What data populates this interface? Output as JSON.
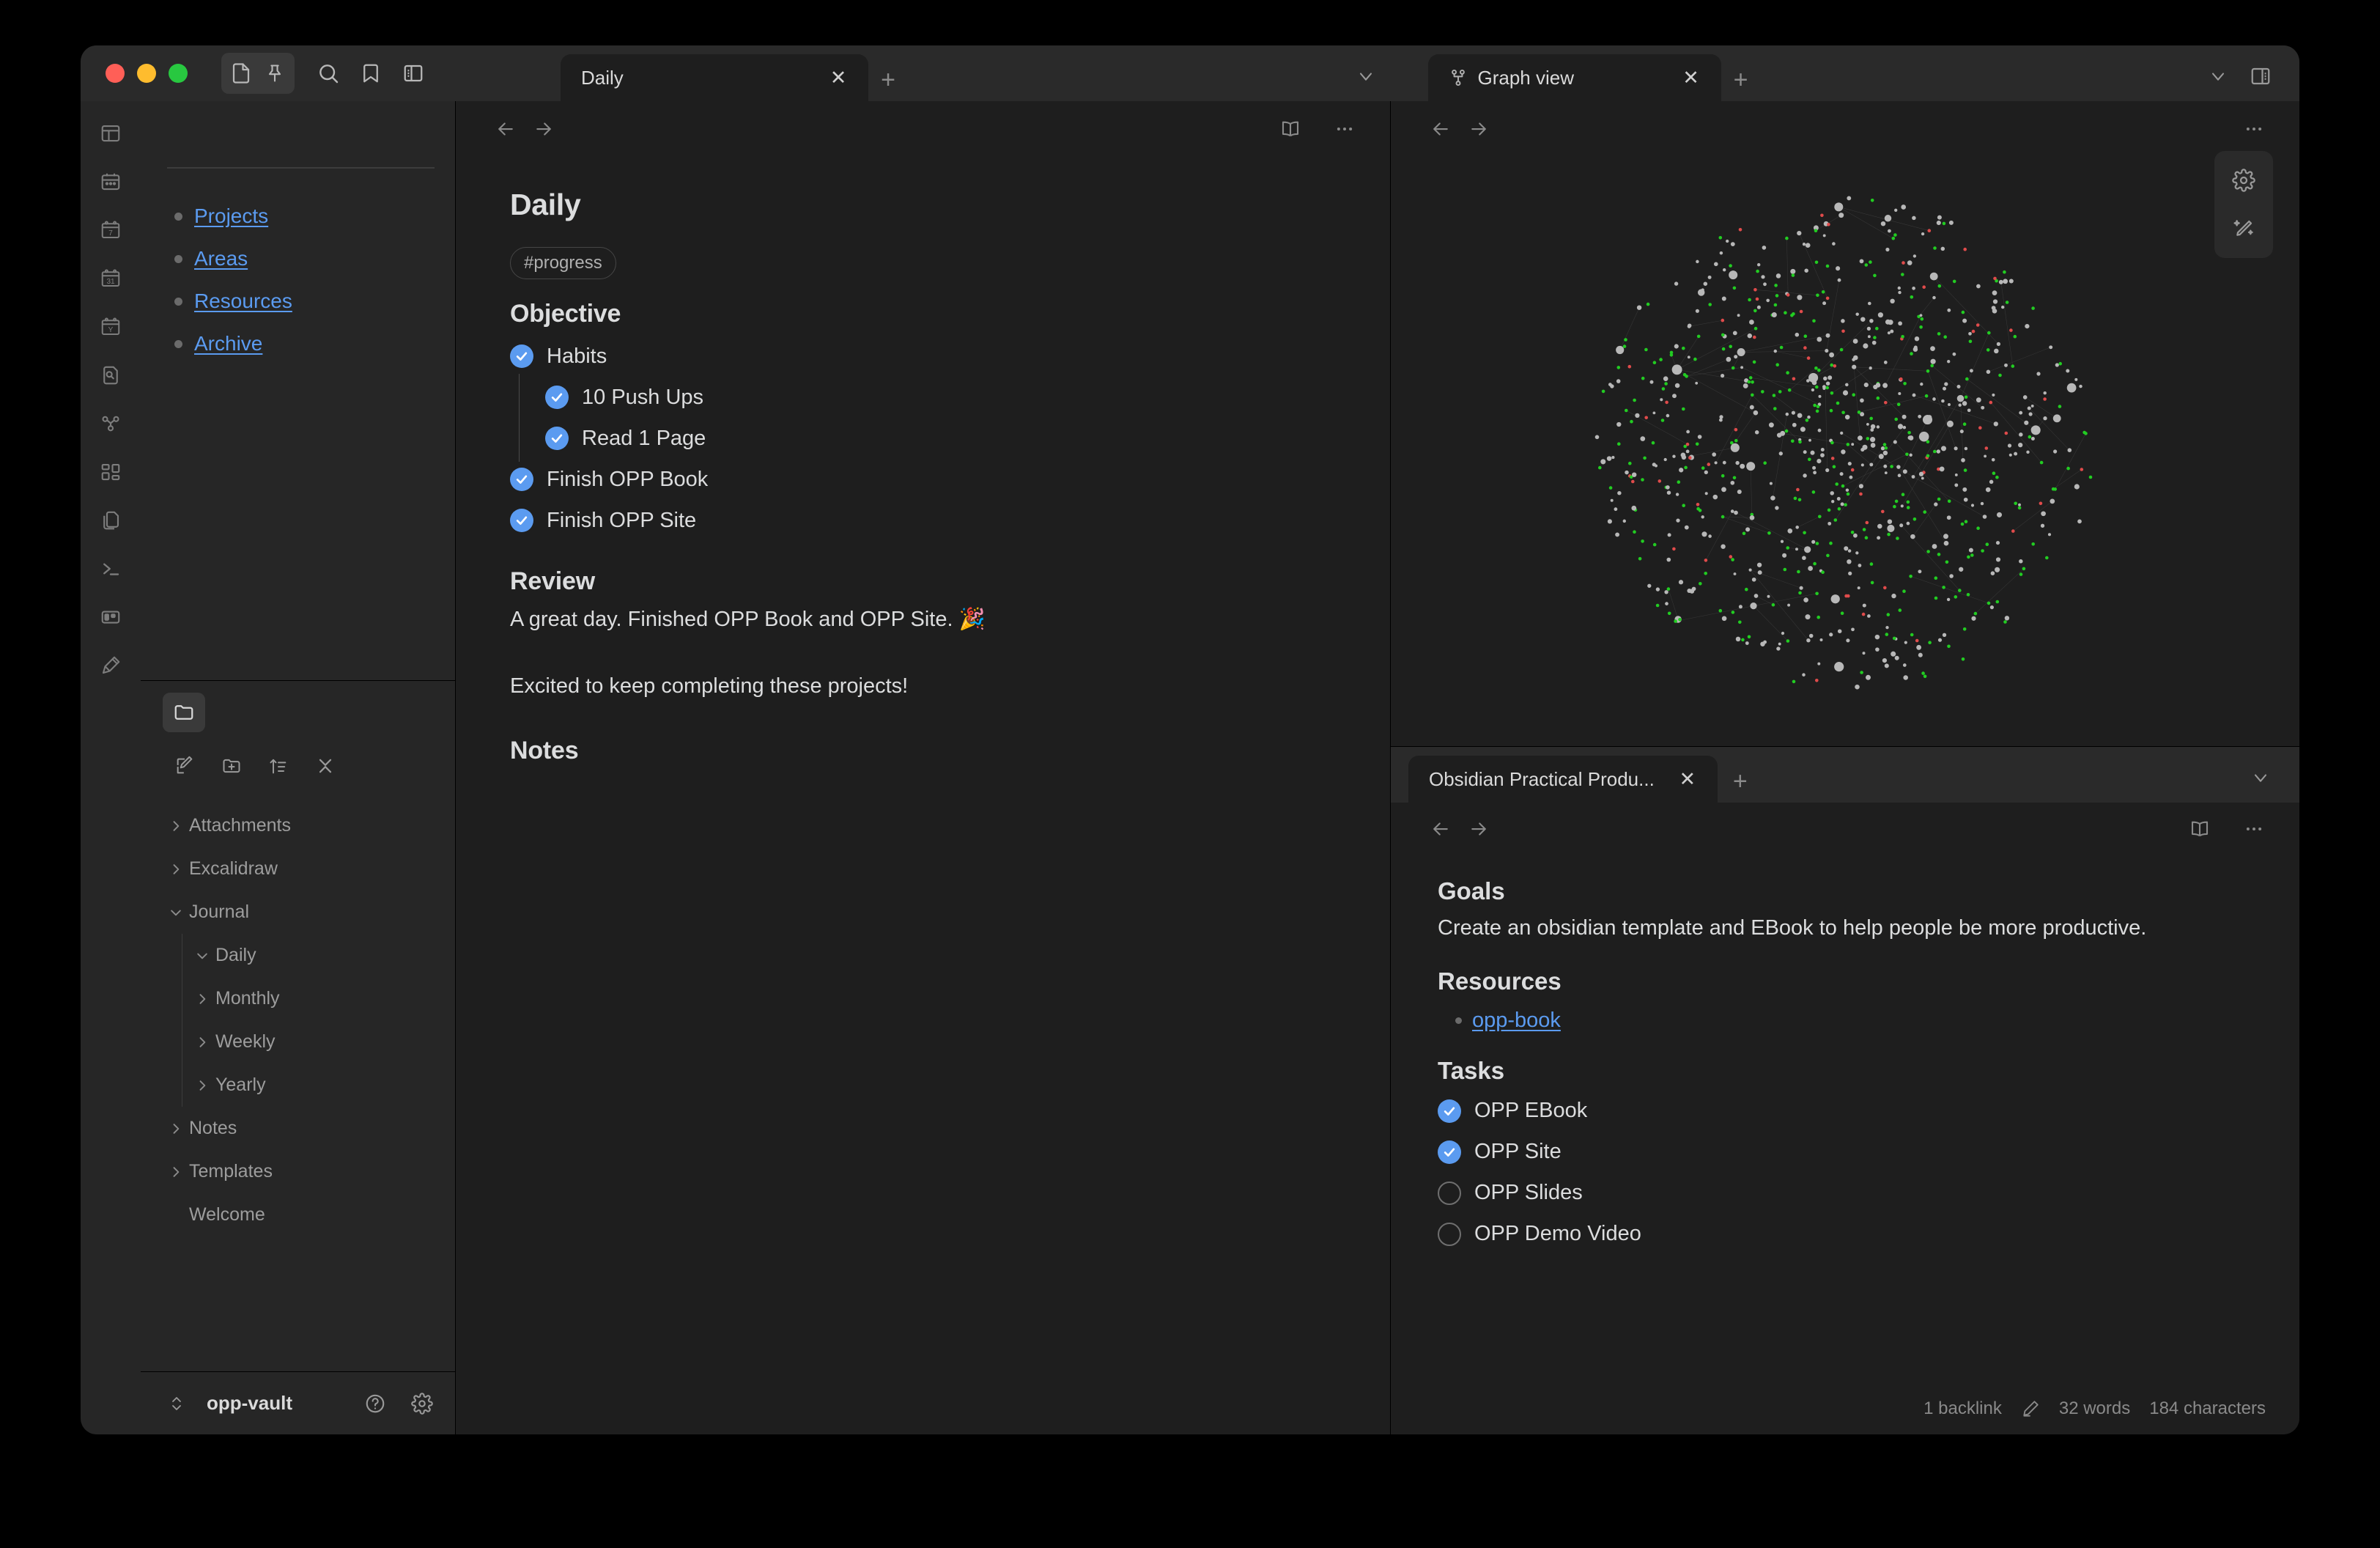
{
  "window": {
    "traffic_lights": [
      "close",
      "minimize",
      "maximize"
    ],
    "toolbar_icons": [
      "file-icon",
      "pin-icon",
      "search-icon",
      "bookmark-icon",
      "toggle-right-sidebar-icon"
    ]
  },
  "rail": {
    "items": [
      {
        "name": "layout-icon",
        "label": "Layout"
      },
      {
        "name": "calendar-icon",
        "label": "Calendar"
      },
      {
        "name": "calendar-weekly-icon",
        "label": "7"
      },
      {
        "name": "calendar-monthly-icon",
        "label": "31"
      },
      {
        "name": "calendar-yearly-icon",
        "label": "Y"
      },
      {
        "name": "file-search-icon",
        "label": "Search in file"
      },
      {
        "name": "graph-icon",
        "label": "Graph view"
      },
      {
        "name": "grid-icon",
        "label": "Dashboard"
      },
      {
        "name": "files-icon",
        "label": "Files"
      },
      {
        "name": "terminal-icon",
        "label": "Terminal"
      },
      {
        "name": "kanban-icon",
        "label": "Kanban"
      },
      {
        "name": "excalidraw-icon",
        "label": "Excalidraw"
      }
    ]
  },
  "sidebar": {
    "para_links": [
      "Projects",
      "Areas",
      "Resources",
      "Archive"
    ],
    "explorer_actions": [
      "new-note-icon",
      "new-folder-icon",
      "sort-icon",
      "collapse-all-icon"
    ],
    "tree": [
      {
        "label": "Attachments",
        "level": 1,
        "state": "collapsed"
      },
      {
        "label": "Excalidraw",
        "level": 1,
        "state": "collapsed"
      },
      {
        "label": "Journal",
        "level": 1,
        "state": "expanded"
      },
      {
        "label": "Daily",
        "level": 2,
        "state": "expanded"
      },
      {
        "label": "Monthly",
        "level": 2,
        "state": "collapsed"
      },
      {
        "label": "Weekly",
        "level": 2,
        "state": "collapsed"
      },
      {
        "label": "Yearly",
        "level": 2,
        "state": "collapsed"
      },
      {
        "label": "Notes",
        "level": 1,
        "state": "collapsed"
      },
      {
        "label": "Templates",
        "level": 1,
        "state": "collapsed"
      },
      {
        "label": "Welcome",
        "level": 1,
        "state": "file"
      }
    ],
    "vault_name": "opp-vault",
    "footer_icons": [
      "vault-switcher-icon",
      "help-icon",
      "settings-icon"
    ]
  },
  "center_pane": {
    "tab": {
      "label": "Daily",
      "close": "✕"
    },
    "new_tab": "+",
    "chevron": "⌄",
    "header_icons": [
      "back-icon",
      "forward-icon",
      "reading-mode-icon",
      "more-options-icon"
    ],
    "note": {
      "title": "Daily",
      "tag": "#progress",
      "objective_heading": "Objective",
      "tasks": [
        {
          "label": "Habits",
          "checked": true,
          "indent": 0
        },
        {
          "label": "10 Push Ups",
          "checked": true,
          "indent": 1
        },
        {
          "label": "Read 1 Page",
          "checked": true,
          "indent": 1
        },
        {
          "label": "Finish OPP Book",
          "checked": true,
          "indent": 0
        },
        {
          "label": "Finish OPP Site",
          "checked": true,
          "indent": 0
        }
      ],
      "review_heading": "Review",
      "review_line1": "A great day. Finished OPP Book and OPP Site. 🎉",
      "review_line2": "Excited to keep completing these projects!",
      "notes_heading": "Notes"
    }
  },
  "graph_pane": {
    "tab": {
      "label": "Graph view",
      "close": "✕",
      "icon": "graph-icon"
    },
    "new_tab": "+",
    "chevron": "⌄",
    "sidebar_toggle_icon": "toggle-right-sidebar-icon",
    "header_icons": [
      "back-icon",
      "forward-icon",
      "more-options-icon"
    ],
    "controls": [
      "graph-settings-icon",
      "graph-forces-icon"
    ],
    "node_colors": {
      "default": "#b8b8b8",
      "tag": "#22cc22",
      "unresolved": "#e04b4b",
      "edge": "#4a4a4a"
    }
  },
  "bottom_pane": {
    "tab": {
      "label": "Obsidian Practical Produ...",
      "close": "✕"
    },
    "new_tab": "+",
    "chevron": "⌄",
    "header_icons": [
      "back-icon",
      "forward-icon",
      "reading-mode-icon",
      "more-options-icon"
    ],
    "note": {
      "goals_heading": "Goals",
      "goals_text": "Create an obsidian template and EBook to help people be more productive.",
      "resources_heading": "Resources",
      "resource_link": "opp-book",
      "tasks_heading": "Tasks",
      "tasks": [
        {
          "label": "OPP EBook",
          "checked": true
        },
        {
          "label": "OPP Site",
          "checked": true
        },
        {
          "label": "OPP Slides",
          "checked": false
        },
        {
          "label": "OPP Demo Video",
          "checked": false
        }
      ]
    },
    "status": {
      "backlinks": "1 backlink",
      "edit_icon": "pencil-icon",
      "words": "32 words",
      "characters": "184 characters"
    }
  }
}
